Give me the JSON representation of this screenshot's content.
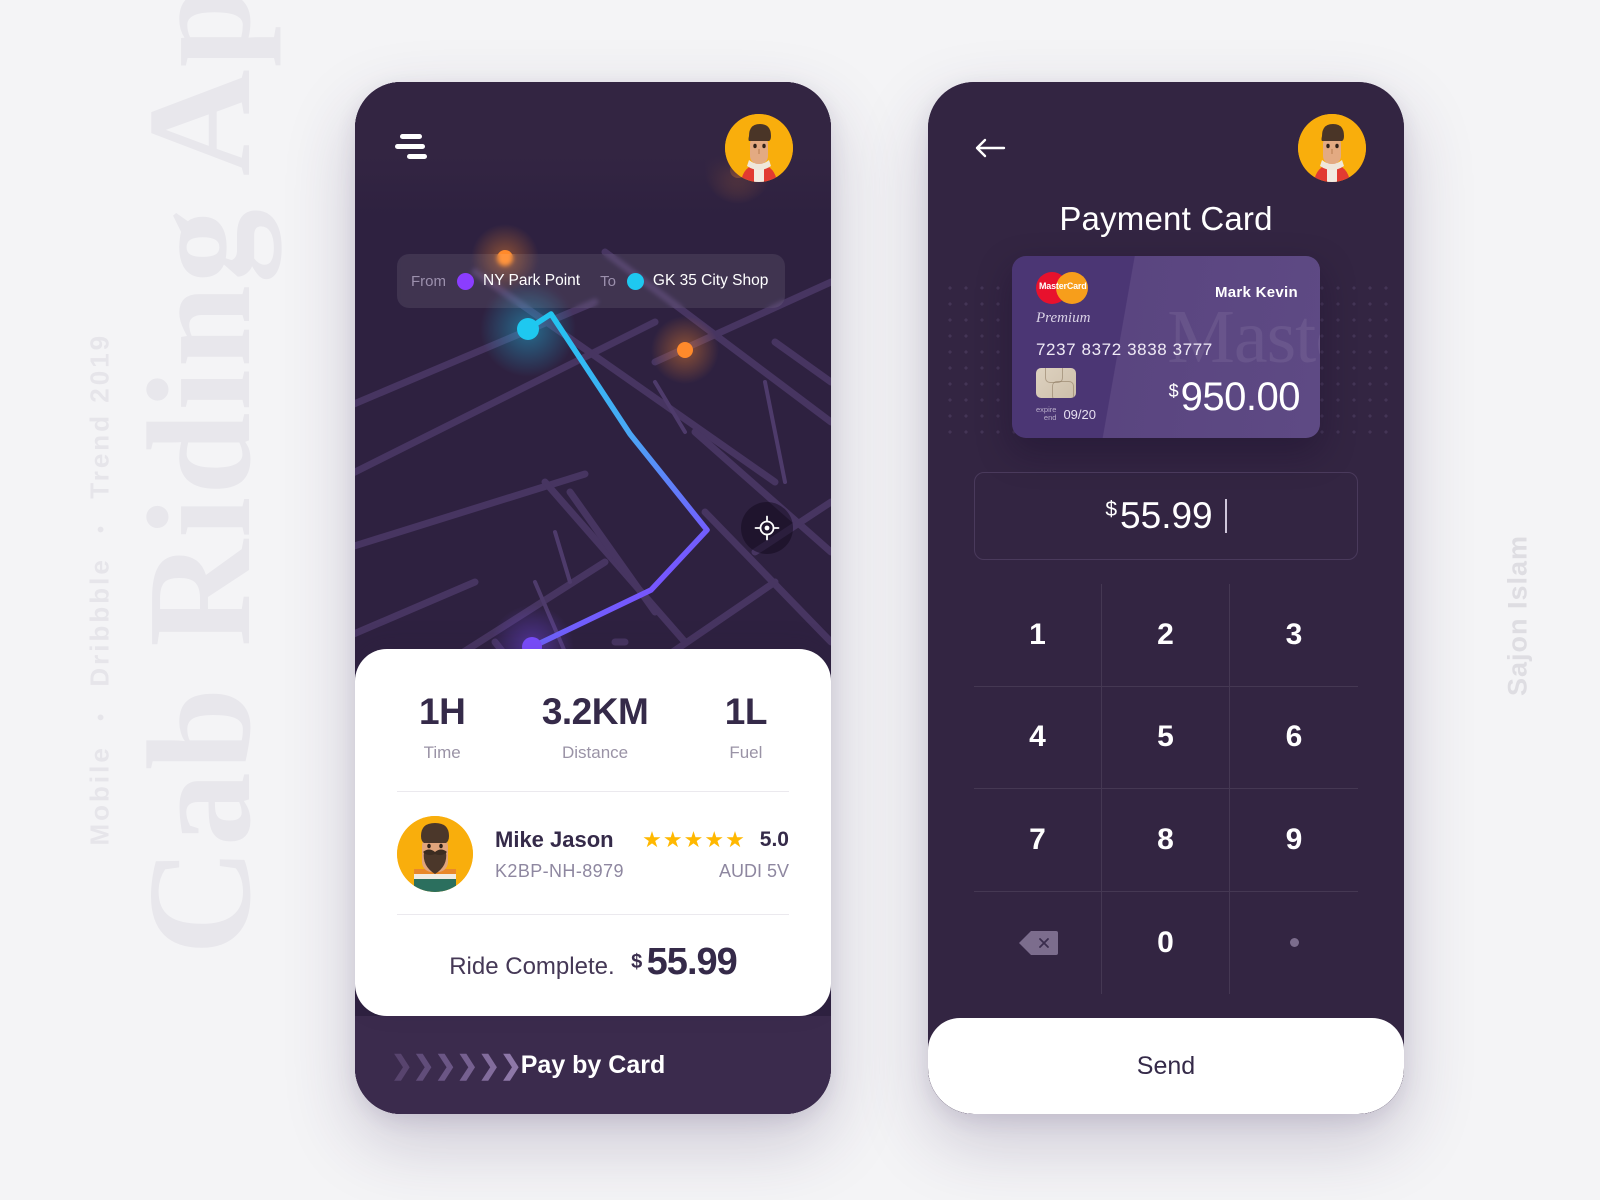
{
  "background": {
    "title": "Cab Riding App",
    "meta": [
      "Mobile",
      "Dribbble",
      "Trend 2019"
    ],
    "meta_separator": "•",
    "author": "Sajon Islam"
  },
  "left_screen": {
    "menu_icon": "hamburger-icon",
    "avatar_icon": "user-avatar",
    "route": {
      "from_label": "From",
      "from_value": "NY Park Point",
      "from_color": "#8b3dff",
      "to_label": "To",
      "to_value": "GK 35 City Shop",
      "to_color": "#1ec8f0"
    },
    "locate_icon": "crosshair-icon",
    "stats": [
      {
        "value": "1H",
        "label": "Time"
      },
      {
        "value": "3.2KM",
        "label": "Distance"
      },
      {
        "value": "1L",
        "label": "Fuel"
      }
    ],
    "driver": {
      "name": "Mike Jason",
      "plate": "K2BP-NH-8979",
      "car": "AUDI 5V",
      "stars": "★★★★★",
      "score": "5.0",
      "star_color": "#ffb800"
    },
    "fare": {
      "label": "Ride Complete.",
      "currency": "$",
      "amount": "55.99"
    },
    "pay_button": {
      "label": "Pay by Card",
      "chevrons": "❯❯❯❯❯❯"
    }
  },
  "right_screen": {
    "back_icon": "arrow-left-icon",
    "avatar_icon": "user-avatar",
    "title": "Payment Card",
    "card": {
      "brand": "MasterCard",
      "brand_red": "#e8112d",
      "brand_orange": "#f79e1b",
      "tier": "Premium",
      "holder": "Mark Kevin",
      "number": "7237  8372  3838 3777",
      "expire_label_line1": "expire",
      "expire_label_line2": "end",
      "expire_value": "09/20",
      "watermark": "Maste",
      "balance_currency": "$",
      "balance_amount": "950.00"
    },
    "amount_input": {
      "currency": "$",
      "value": "55.99"
    },
    "keypad": [
      {
        "label": "1",
        "name": "key-1"
      },
      {
        "label": "2",
        "name": "key-2"
      },
      {
        "label": "3",
        "name": "key-3"
      },
      {
        "label": "4",
        "name": "key-4"
      },
      {
        "label": "5",
        "name": "key-5"
      },
      {
        "label": "6",
        "name": "key-6"
      },
      {
        "label": "7",
        "name": "key-7"
      },
      {
        "label": "8",
        "name": "key-8"
      },
      {
        "label": "9",
        "name": "key-9"
      },
      {
        "label": "",
        "name": "key-backspace"
      },
      {
        "label": "0",
        "name": "key-0"
      },
      {
        "label": "",
        "name": "key-decimal"
      }
    ],
    "send_button": {
      "label": "Send"
    }
  },
  "theme": {
    "phone_bg": "#332542",
    "map_bg": "#2e2140",
    "card_white": "#ffffff",
    "accent_purple": "#8b3dff",
    "accent_cyan": "#1ec8f0",
    "marker_orange": "#ff8a2b",
    "paybar_bg": "#3b2b4d"
  }
}
